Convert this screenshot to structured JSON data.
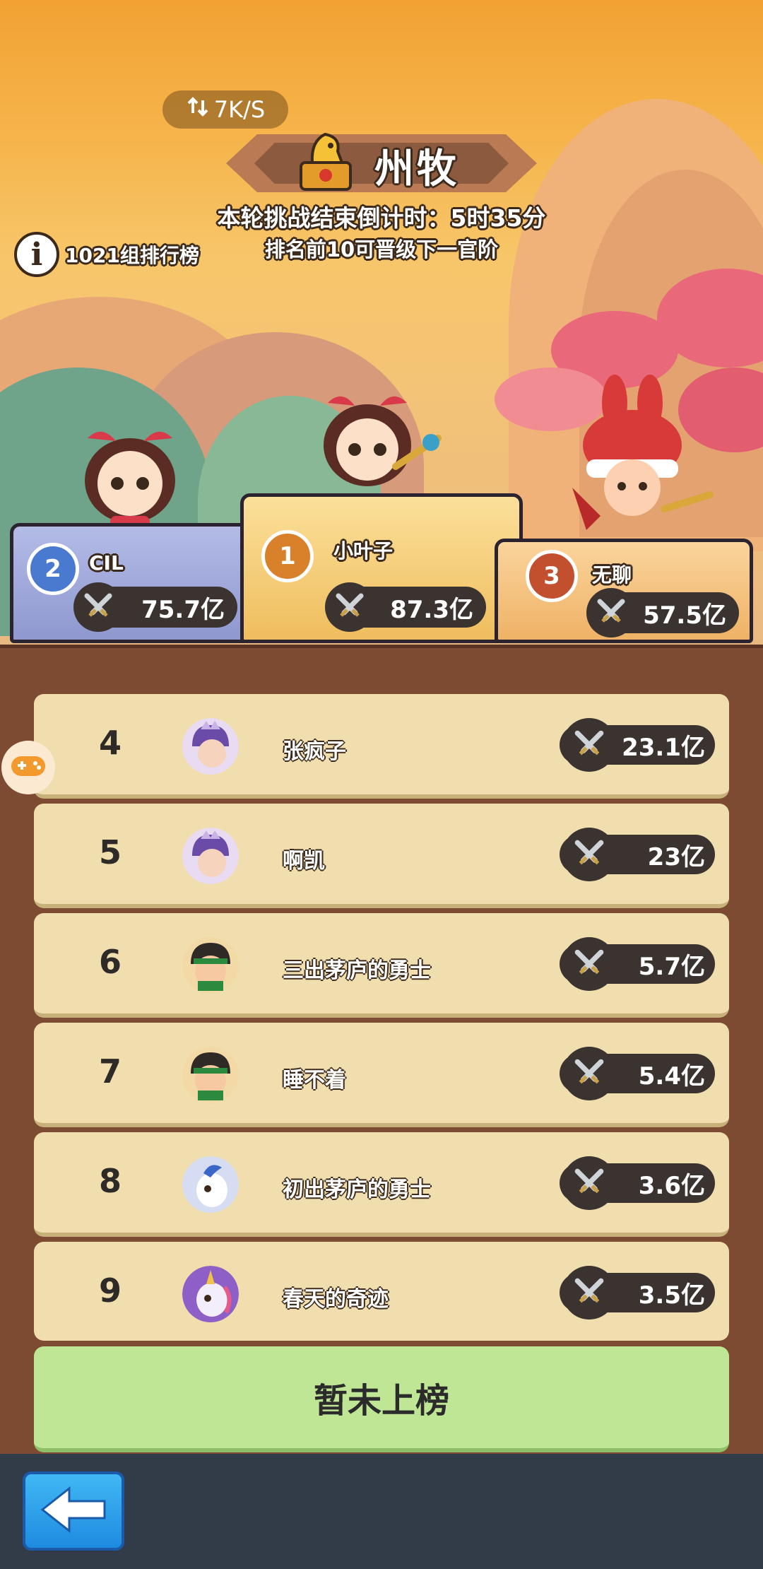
{
  "header": {
    "net_speed": "7K/S",
    "title": "州牧",
    "countdown": "本轮挑战结束倒计时：5时35分",
    "promotion_note": "排名前10可晋级下一官阶",
    "group_label": "1021组排行榜"
  },
  "podium": {
    "first": {
      "rank": "1",
      "name": "小叶子",
      "power": "87.3亿"
    },
    "second": {
      "rank": "2",
      "name": "CIL",
      "power": "75.7亿"
    },
    "third": {
      "rank": "3",
      "name": "无聊",
      "power": "57.5亿"
    }
  },
  "leaderboard": [
    {
      "rank": "4",
      "name": "张疯子",
      "power": "23.1亿",
      "avatar": "purple-hero-avatar"
    },
    {
      "rank": "5",
      "name": "啊凯",
      "power": "23亿",
      "avatar": "purple-hero-avatar"
    },
    {
      "rank": "6",
      "name": "三出茅庐的勇士",
      "power": "5.7亿",
      "avatar": "green-headband-hero-avatar"
    },
    {
      "rank": "7",
      "name": "睡不着",
      "power": "5.4亿",
      "avatar": "green-headband-hero-avatar"
    },
    {
      "rank": "8",
      "name": "初出茅庐的勇士",
      "power": "3.6亿",
      "avatar": "unicorn-avatar"
    },
    {
      "rank": "9",
      "name": "春天的奇迹",
      "power": "3.5亿",
      "avatar": "unicorn-avatar"
    }
  ],
  "my_status": "暂未上榜",
  "colors": {
    "gold": "#f5c65a",
    "silver": "#9fa8d8",
    "bronze": "#f3b25f",
    "row_bg": "#f0deae",
    "board_bg": "#7d4b32",
    "my_status_bg": "#bfe695",
    "back_button": "#2aa0ea"
  }
}
